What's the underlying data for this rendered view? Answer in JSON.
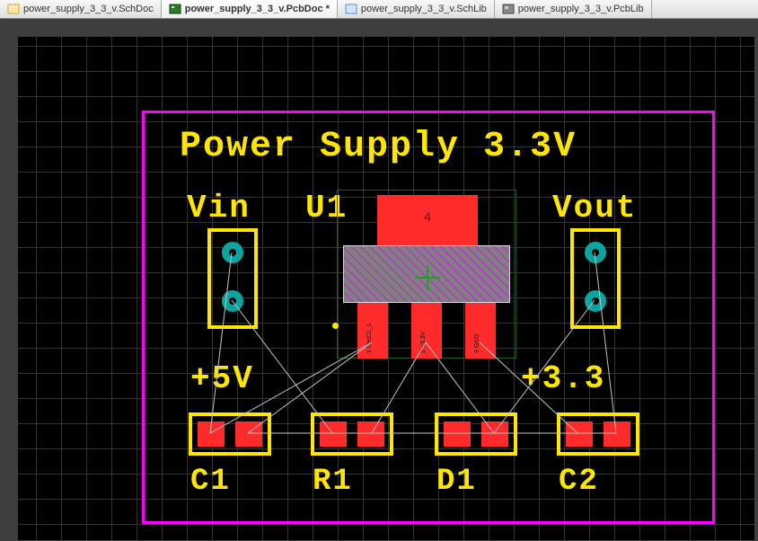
{
  "tabs": [
    {
      "label": "power_supply_3_3_v.SchDoc",
      "active": false
    },
    {
      "label": "power_supply_3_3_v.PcbDoc *",
      "active": true
    },
    {
      "label": "power_supply_3_3_v.SchLib",
      "active": false
    },
    {
      "label": "power_supply_3_3_v.PcbLib",
      "active": false
    }
  ],
  "board": {
    "title": "Power Supply 3.3V",
    "labels": {
      "vin": "Vin",
      "vout": "Vout",
      "v5": "+5V",
      "v33": "+3.3"
    },
    "des": {
      "u1": "U1",
      "c1": "C1",
      "r1": "R1",
      "d1": "D1",
      "c2": "C2"
    },
    "u1_tab_num": "4",
    "pad_tiny": {
      "p1": "1 NetC1_1",
      "p2": "2 +3.3V",
      "p3": "3 GND"
    }
  }
}
